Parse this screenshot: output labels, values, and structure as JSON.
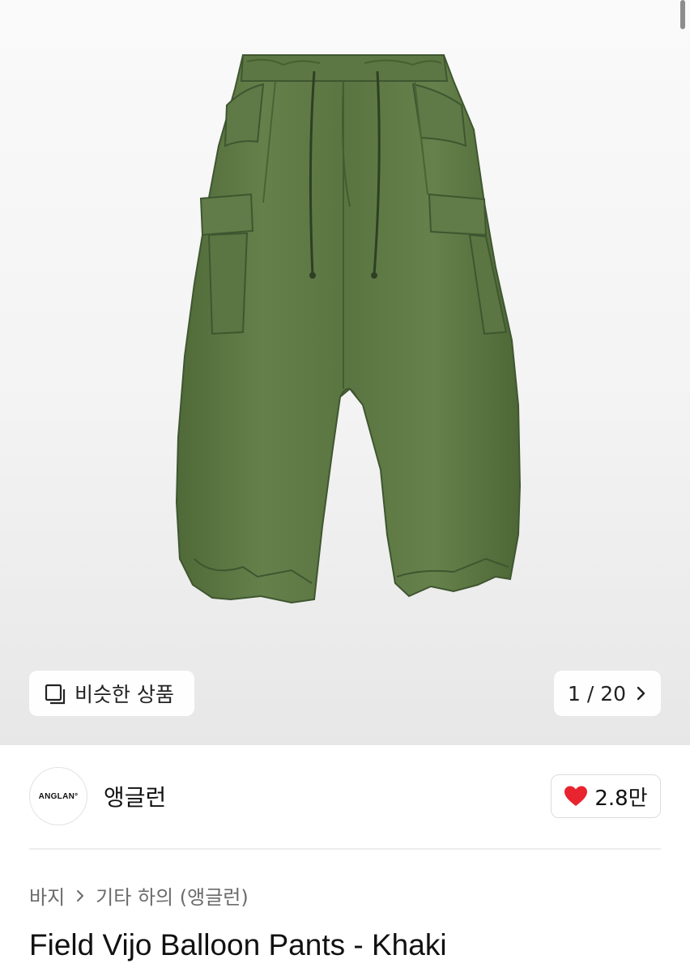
{
  "gallery": {
    "image_alt": "Khaki balloon cargo pants",
    "similar_button_label": "비슷한 상품",
    "similar_icon": "similar-products-icon",
    "counter_text": "1 / 20",
    "next_icon": "chevron-right-icon"
  },
  "seller": {
    "logo_text": "ANGLAN°",
    "name": "앵글런"
  },
  "likes": {
    "icon": "heart-icon",
    "count": "2.8만",
    "heart_color": "#e8242f"
  },
  "breadcrumb": {
    "items": [
      "바지",
      "기타 하의 (앵글런)"
    ],
    "separator_icon": "chevron-right-icon"
  },
  "product": {
    "title": "Field Vijo Balloon Pants - Khaki",
    "color": "#5f7a45"
  }
}
